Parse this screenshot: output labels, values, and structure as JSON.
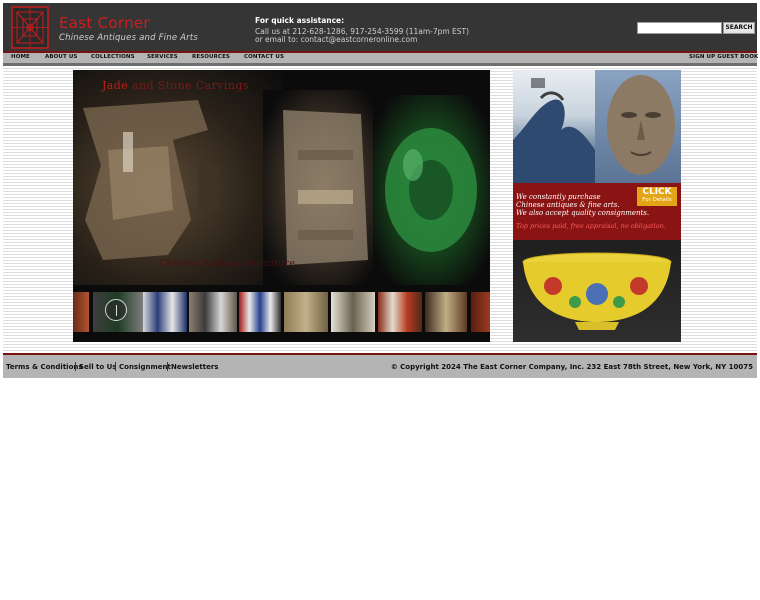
{
  "header": {
    "brand_name": "East Corner",
    "tagline": "Chinese Antiques and Fine Arts",
    "assistance_title": "For quick assistance:",
    "assistance_phone": "Call us at 212-628-1286, 917-254-3599 (11am-7pm EST)",
    "assistance_email": "or email to: contact@eastcorneronline.com",
    "search_placeholder": "",
    "search_button": "SEARCH"
  },
  "nav": {
    "items": [
      {
        "label": "HOME"
      },
      {
        "label": "ABOUT US"
      },
      {
        "label": "COLLECTIONS"
      },
      {
        "label": "SERVICES"
      },
      {
        "label": "RESOURCES"
      },
      {
        "label": "CONTACT US"
      }
    ],
    "guestbook": "SIGN UP GUEST BOOK"
  },
  "slideshow": {
    "heading_part1": "Jade",
    "heading_part2": " and Stone Carvings",
    "subheading": "Chinese Antique Furniture"
  },
  "ad": {
    "text_line1": "We constantly purchase",
    "text_line2": "Chinese antiques & fine arts.",
    "text_line3": "We also accept quality consignments.",
    "note": "Top prices paid, free appraisal, no obligation.",
    "click_big": "CLICK",
    "click_small": "For Details"
  },
  "footer": {
    "links": [
      "Terms & Conditions",
      "Sell to Us",
      "Consignment",
      "Newsletters"
    ],
    "copyright": "© Copyright 2024 The East Corner Company, Inc.      232 East 78th Street, New York, NY 10075"
  },
  "colors": {
    "header_bg": "#353535",
    "brand_red": "#d21b1b",
    "nav_bg": "#b4b4b4",
    "accent_dark_red": "#7b1212",
    "ad_red": "#8a1414",
    "click_gold": "#e3a417"
  }
}
